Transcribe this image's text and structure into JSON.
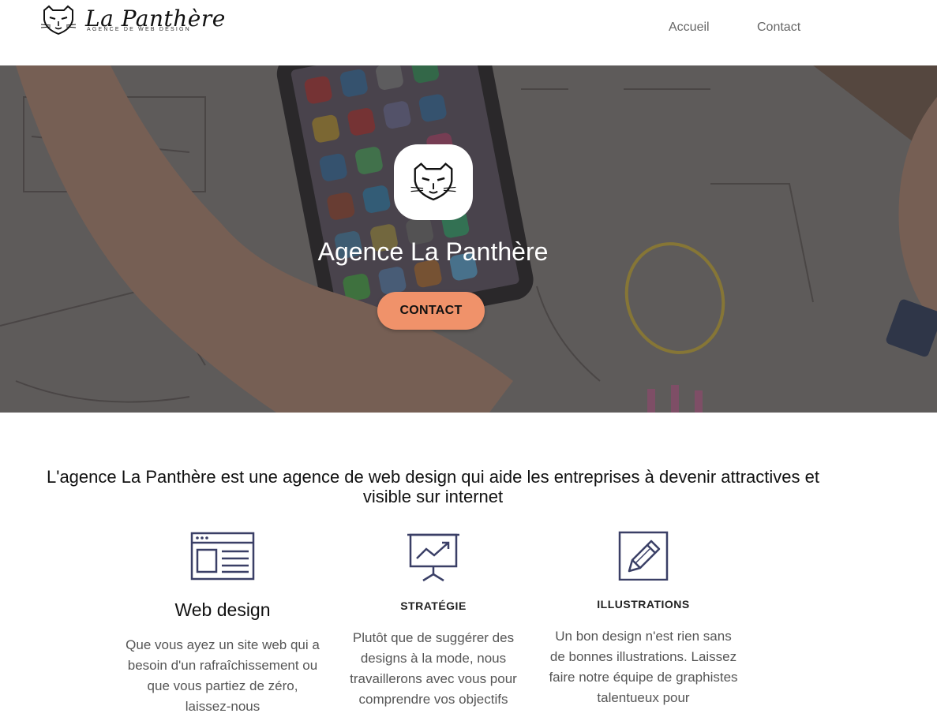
{
  "header": {
    "brand_name": "La Panthère",
    "brand_tagline": "AGENCE DE WEB DESIGN",
    "nav": [
      {
        "label": "Accueil"
      },
      {
        "label": "Contact"
      }
    ]
  },
  "hero": {
    "title": "Agence La Panthère",
    "cta_label": "CONTACT"
  },
  "intro": {
    "text": "L'agence La Panthère est une agence de web design qui aide les entreprises à devenir attractives et visible sur internet"
  },
  "services": [
    {
      "icon": "browser-window-icon",
      "title": "Web design",
      "text": "Que vous ayez un site web qui a besoin d'un rafraîchissement ou que vous partiez de zéro, laissez-nous"
    },
    {
      "icon": "presentation-chart-icon",
      "title": "STRATÉGIE",
      "text": "Plutôt que de suggérer des designs à la mode, nous travaillerons avec vous pour comprendre vos objectifs"
    },
    {
      "icon": "pencil-icon",
      "title": "ILLUSTRATIONS",
      "text": "Un bon design n'est rien sans de bonnes illustrations. Laissez faire notre équipe de graphistes talentueux pour"
    }
  ],
  "colors": {
    "accent": "#f0926a",
    "icon_stroke": "#3a3f66"
  }
}
